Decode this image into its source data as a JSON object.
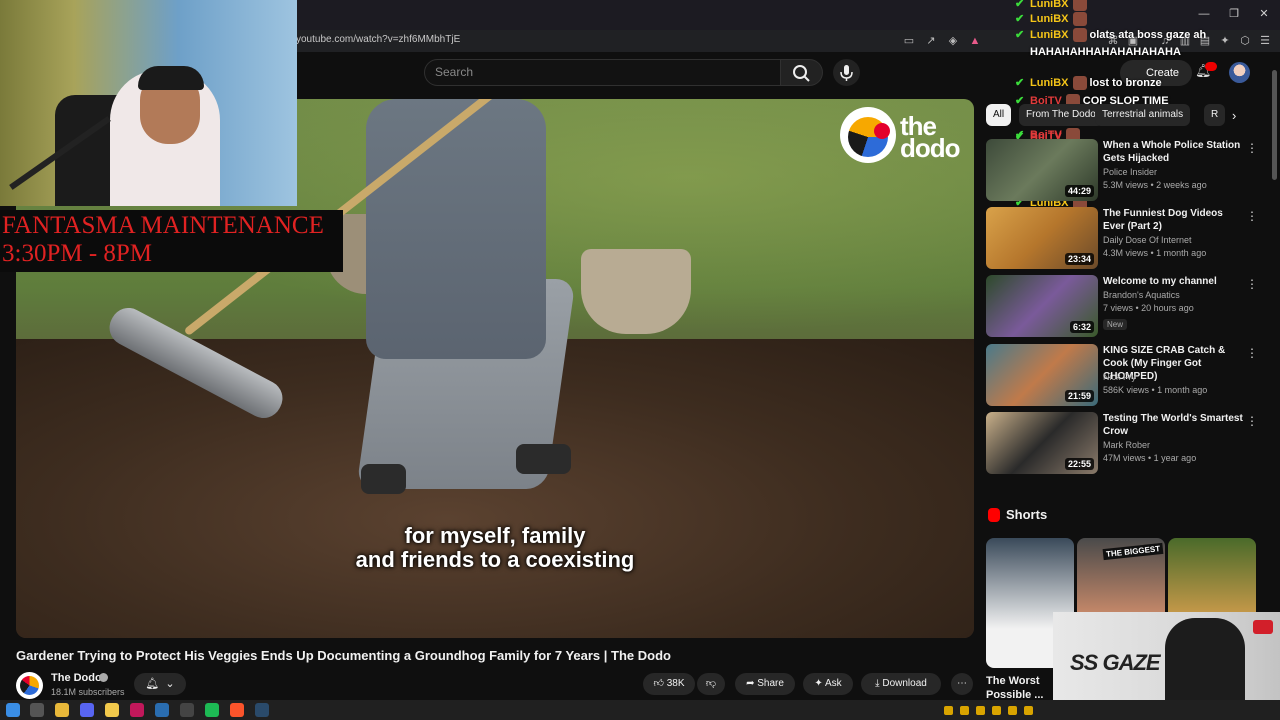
{
  "browser": {
    "url": "youtube.com/watch?v=zhf6MMbhTjE"
  },
  "youtube": {
    "search_placeholder": "Search",
    "create_label": "Create"
  },
  "video": {
    "title": "Gardener Trying to Protect His Veggies Ends Up Documenting a Groundhog Family for 7 Years | The Dodo",
    "subtitle_line1": "for myself, family",
    "subtitle_line2": "and friends to a coexisting",
    "logo_text_line1": "the",
    "logo_text_line2": "dodo",
    "channel": {
      "name": "The Dodo",
      "subscribers": "18.1M subscribers"
    },
    "actions": {
      "likes": "38K",
      "share": "Share",
      "ask": "Ask",
      "download": "Download"
    }
  },
  "overlay": {
    "banner_line1": "FANTASMA MAINTENANCE",
    "banner_line2": "3:30PM - 8PM",
    "chat": [
      {
        "user": "LuniBX",
        "user_color": "#f5c518",
        "msg": ""
      },
      {
        "user": "LuniBX",
        "user_color": "#f5c518",
        "msg": ""
      },
      {
        "user": "LuniBX",
        "user_color": "#f5c518",
        "msg": "olats ata boss gaze ah"
      },
      {
        "user": "",
        "user_color": "#f5c518",
        "msg": "HAHAHAHHAHAHAHAHAHA"
      },
      {
        "user": "LuniBX",
        "user_color": "#f5c518",
        "msg": "lost to bronze"
      },
      {
        "user": "BoiTV",
        "user_color": "#e23b3b",
        "msg": "COP SLOP TIME"
      },
      {
        "user": "BoiTV",
        "user_color": "#e23b3b",
        "msg": ""
      },
      {
        "user": "LuniBX",
        "user_color": "#f5c518",
        "msg": ""
      },
      {
        "user": "LuniBX",
        "user_color": "#f5c518",
        "msg": ""
      },
      {
        "user": "LuniBX",
        "user_color": "#f5c518",
        "msg": ""
      },
      {
        "user": "BoiTV",
        "user_color": "#e23b3b",
        "msg": ""
      }
    ],
    "ssgaze_text": "SS GAZE"
  },
  "sidebar": {
    "chips": [
      "All",
      "From The Dodo",
      "Terrestrial animals",
      "R"
    ],
    "recommendations": [
      {
        "title": "When a Whole Police Station Gets Hijacked",
        "channel": "Police Insider",
        "meta": "5.3M views • 2 weeks ago",
        "duration": "44:29",
        "thumb": "linear-gradient(135deg,#3d4a3a,#6b7a5c 50%,#2e3a2a)"
      },
      {
        "title": "The Funniest Dog Videos Ever (Part 2)",
        "channel": "Daily Dose Of Internet",
        "meta": "4.3M views • 1 month ago",
        "duration": "23:34",
        "thumb": "linear-gradient(135deg,#d9a24a,#b5762c 50%,#6b4a2a)"
      },
      {
        "title": "Welcome to my channel",
        "channel": "Brandon's Aquatics",
        "meta": "7 views • 20 hours ago",
        "duration": "6:32",
        "thumb": "linear-gradient(135deg,#2d4a2a,#7a5a9a 50%,#3a5a2a)",
        "badge": "New"
      },
      {
        "title": "KING SIZE CRAB Catch & Cook (My Finger Got CHOMPED)",
        "channel": "Nick Fry",
        "meta": "586K views • 1 month ago",
        "duration": "21:59",
        "thumb": "linear-gradient(135deg,#4a7a8a,#c07a4a 50%,#3a6a7a)"
      },
      {
        "title": "Testing The World's Smartest Crow",
        "channel": "Mark Rober",
        "meta": "47M views • 1 year ago",
        "duration": "22:55",
        "thumb": "linear-gradient(135deg,#c9b08a,#2a2a2a 50%,#8a7a6a)"
      }
    ],
    "shorts_label": "Shorts",
    "shorts": [
      {
        "title": "The Worst Possible ...",
        "thumb": "linear-gradient(180deg,#3a4a5a,#f2f2f2 70%)"
      },
      {
        "title": "THE BIGGEST",
        "thumb": "linear-gradient(180deg,#4a4a4a,#c98a6a 60%)"
      },
      {
        "title": "",
        "thumb": "linear-gradient(180deg,#4a6a2a,#c99a4a 60%)"
      }
    ]
  },
  "colors": {
    "accent_red": "#ff0000",
    "chat_check": "#3bdc3b"
  }
}
